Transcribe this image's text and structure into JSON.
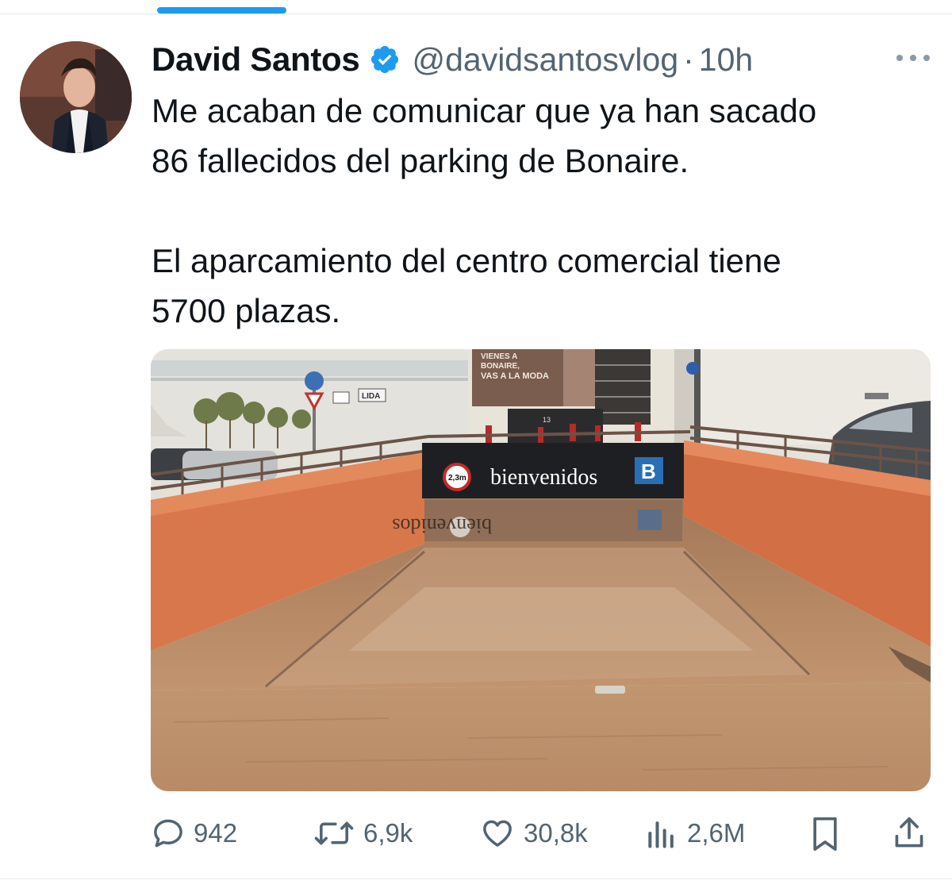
{
  "author": {
    "name": "David Santos",
    "handle": "@davidsantosvlog",
    "separator": "·",
    "time": "10h",
    "verified": true,
    "verified_color": "#1d9bf0"
  },
  "tweet": {
    "lines": [
      "Me acaban de comunicar que ya han sacado",
      "86 fallecidos del parking de Bonaire.",
      "El aparcamiento del centro comercial tiene",
      "5700 plazas."
    ]
  },
  "media": {
    "sign_text": "bienvenidos",
    "sign_logo": "B",
    "height_limit": "2,3m",
    "billboard_lines": [
      "VIENES A",
      "BONAIRE,",
      "VAS A LA MODA"
    ],
    "street_sign": "LIDA",
    "door_number": "13",
    "reflection_text": "bienvenidos"
  },
  "actions": {
    "replies": "942",
    "reposts": "6,9k",
    "likes": "30,8k",
    "views": "2,6M"
  },
  "icons": [
    "verified-badge-icon",
    "more-icon",
    "reply-icon",
    "repost-icon",
    "like-icon",
    "views-icon",
    "bookmark-icon",
    "share-icon"
  ],
  "colors": {
    "accent": "#1d9bf0",
    "text": "#0f1419",
    "secondary": "#536471",
    "divider": "#e6e9eb"
  }
}
